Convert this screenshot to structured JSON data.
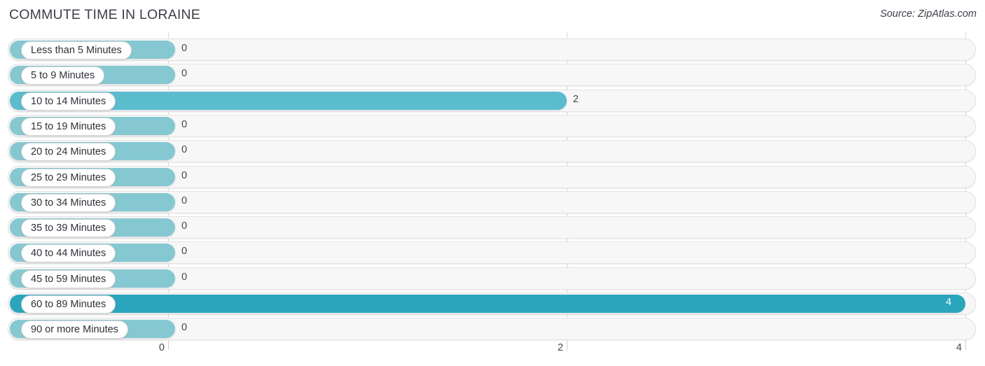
{
  "header": {
    "title": "COMMUTE TIME IN LORAINE",
    "source": "Source: ZipAtlas.com"
  },
  "colors": {
    "bar_zero": "#86c8d2",
    "bar_mid": "#5bbcce",
    "bar_high": "#2ba6bd",
    "track": "#f7f7f7",
    "gridline": "#d8d8d8",
    "text": "#45474e"
  },
  "chart_data": {
    "type": "bar",
    "orientation": "horizontal",
    "title": "COMMUTE TIME IN LORAINE",
    "xlabel": "",
    "ylabel": "",
    "xlim": [
      0,
      4
    ],
    "xticks": [
      "0",
      "2",
      "4"
    ],
    "xtick_values": [
      0,
      2,
      4
    ],
    "grid": true,
    "legend": "none",
    "categories": [
      "Less than 5 Minutes",
      "5 to 9 Minutes",
      "10 to 14 Minutes",
      "15 to 19 Minutes",
      "20 to 24 Minutes",
      "25 to 29 Minutes",
      "30 to 34 Minutes",
      "35 to 39 Minutes",
      "40 to 44 Minutes",
      "45 to 59 Minutes",
      "60 to 89 Minutes",
      "90 or more Minutes"
    ],
    "values": [
      0,
      0,
      2,
      0,
      0,
      0,
      0,
      0,
      0,
      0,
      4,
      0
    ],
    "value_labels": [
      "0",
      "0",
      "2",
      "0",
      "0",
      "0",
      "0",
      "0",
      "0",
      "0",
      "4",
      "0"
    ]
  }
}
